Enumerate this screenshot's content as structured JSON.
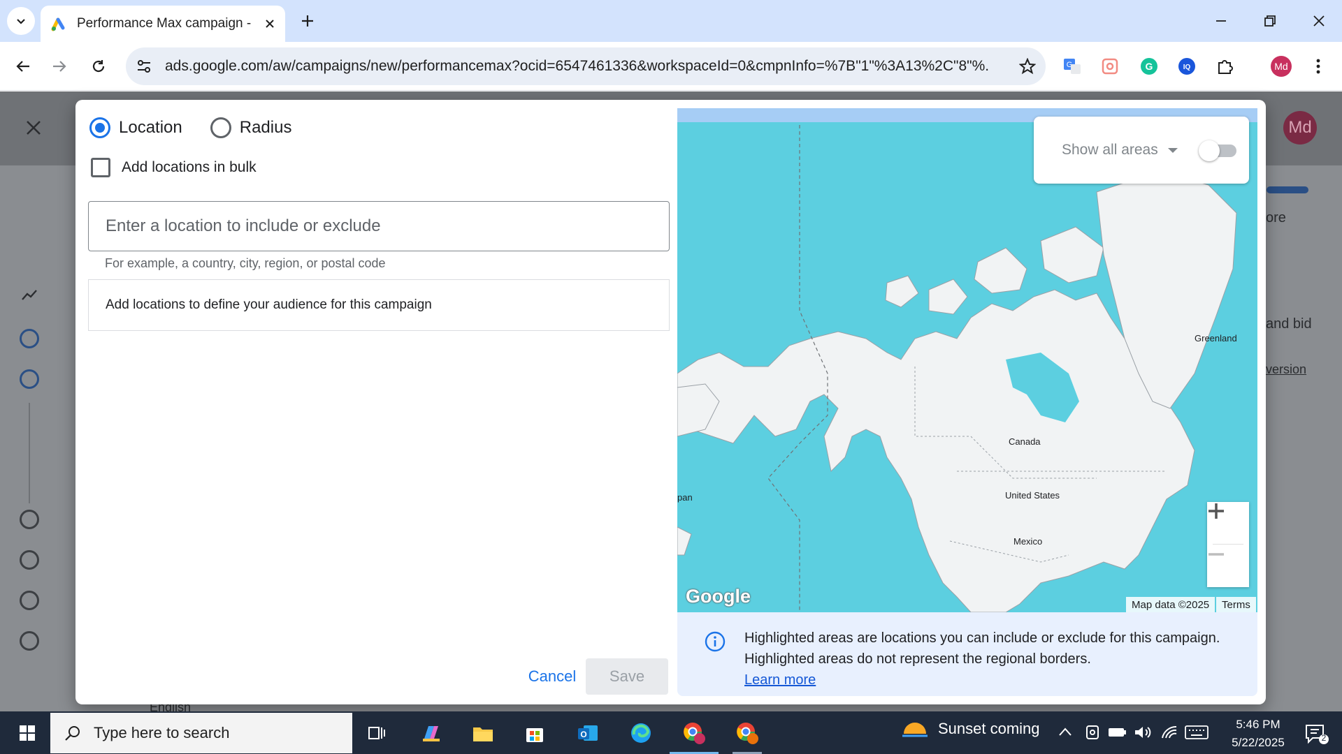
{
  "browser": {
    "tab_title": "Performance Max campaign - P",
    "url": "ads.google.com/aw/campaigns/new/performancemax?ocid=6547461336&workspaceId=0&cmpnInfo=%7B\"1\"%3A13%2C\"8\"%...",
    "profile_initials": "Md"
  },
  "background_page": {
    "avatar_initials": "Md",
    "snippet_more": "ore",
    "snippet_bid": "and bid",
    "snippet_version": "version",
    "snippet_english": "English"
  },
  "modal": {
    "location_option": "Location",
    "radius_option": "Radius",
    "bulk_label": "Add locations in bulk",
    "input_placeholder": "Enter a location to include or exclude",
    "input_value": "",
    "hint": "For example, a country, city, region, or postal code",
    "empty_message": "Add locations to define your audience for this campaign",
    "cancel_label": "Cancel",
    "save_label": "Save"
  },
  "map": {
    "show_all_areas": "Show all areas",
    "show_all_areas_enabled": false,
    "labels": {
      "greenland": "Greenland",
      "canada": "Canada",
      "united_states": "United States",
      "mexico": "Mexico",
      "japan": "pan"
    },
    "google_logo": "Google",
    "map_data": "Map data ©2025",
    "terms": "Terms",
    "info_text": "Highlighted areas are locations you can include or exclude for this campaign. Highlighted areas do not represent the regional borders.",
    "learn_more": "Learn more"
  },
  "taskbar": {
    "search_placeholder": "Type here to search",
    "weather": "Sunset coming",
    "time": "5:46 PM",
    "date": "5/22/2025",
    "notification_count": "2"
  },
  "colors": {
    "accent": "#1a73e8",
    "water": "#5ccfe0",
    "land": "#f1f3f4",
    "taskbar": "#1f2a3b"
  }
}
